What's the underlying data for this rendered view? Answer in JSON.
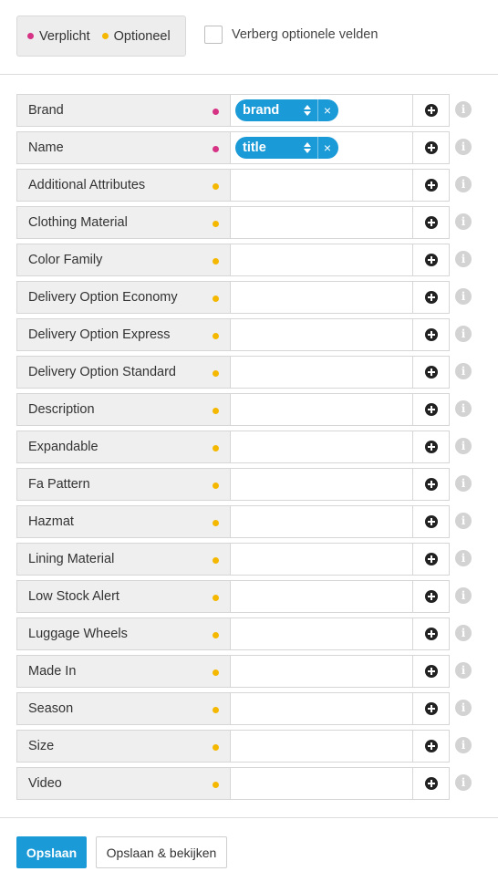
{
  "legend": {
    "required_label": "Verplicht",
    "optional_label": "Optioneel",
    "required_color": "#d63384",
    "optional_color": "#f5b800"
  },
  "hide_optional": {
    "label": "Verberg optionele velden",
    "checked": false
  },
  "fields": [
    {
      "label": "Brand",
      "required": true,
      "tag": "brand",
      "add_icon": "plus-circle-icon",
      "info_icon": "info-icon"
    },
    {
      "label": "Name",
      "required": true,
      "tag": "title",
      "add_icon": "plus-circle-icon",
      "info_icon": "info-icon"
    },
    {
      "label": "Additional Attributes",
      "required": false
    },
    {
      "label": "Clothing Material",
      "required": false
    },
    {
      "label": "Color Family",
      "required": false
    },
    {
      "label": "Delivery Option Economy",
      "required": false
    },
    {
      "label": "Delivery Option Express",
      "required": false
    },
    {
      "label": "Delivery Option Standard",
      "required": false
    },
    {
      "label": "Description",
      "required": false
    },
    {
      "label": "Expandable",
      "required": false
    },
    {
      "label": "Fa Pattern",
      "required": false
    },
    {
      "label": "Hazmat",
      "required": false
    },
    {
      "label": "Lining Material",
      "required": false
    },
    {
      "label": "Low Stock Alert",
      "required": false
    },
    {
      "label": "Luggage Wheels",
      "required": false
    },
    {
      "label": "Made In",
      "required": false
    },
    {
      "label": "Season",
      "required": false
    },
    {
      "label": "Size",
      "required": false
    },
    {
      "label": "Video",
      "required": false
    }
  ],
  "footer": {
    "save_label": "Opslaan",
    "save_view_label": "Opslaan & bekijken",
    "primary_color": "#1a9ad7"
  },
  "icons": {
    "tag_remove": "×",
    "info": "i"
  }
}
